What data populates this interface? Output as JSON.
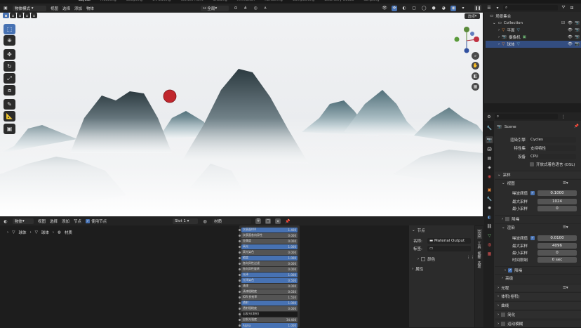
{
  "topbar": {
    "tabs": [
      "Layout",
      "Modeling",
      "Sculpting",
      "UV Editing",
      "Texture Paint",
      "Shading",
      "Animation",
      "Rendering",
      "Compositing",
      "Geometry Nodes",
      "Scripting"
    ],
    "active_tab": "Layout"
  },
  "viewport_header": {
    "mode": "物体模式",
    "menus": [
      "视图",
      "选择",
      "添加",
      "物体"
    ],
    "transform_orientation": "全局",
    "options_label": "选项"
  },
  "node_editor": {
    "header": {
      "type": "物体",
      "menus": [
        "视图",
        "选择",
        "添加",
        "节点"
      ],
      "use_nodes_label": "使用节点",
      "slot": "Slot 1",
      "material": "材质"
    },
    "breadcrumb": [
      "球体",
      "球体",
      "材质"
    ],
    "bsdf_rows": [
      {
        "label": "次表面IOR",
        "value": "1.400",
        "style": "b"
      },
      {
        "label": "次表面各向异性",
        "value": "0.000",
        "style": "g"
      },
      {
        "label": "金属度",
        "value": "0.000",
        "style": "g"
      },
      {
        "label": "高光",
        "value": "1.000",
        "style": "b"
      },
      {
        "label": "高光染色",
        "value": "0.000",
        "style": "g"
      },
      {
        "label": "糙度",
        "value": "1.000",
        "style": "b"
      },
      {
        "label": "各向异性过滤",
        "value": "0.000",
        "style": "g"
      },
      {
        "label": "各向异性旋转",
        "value": "0.000",
        "style": "g"
      },
      {
        "label": "光泽",
        "value": "1.000",
        "style": "b"
      },
      {
        "label": "光泽染色",
        "value": "0.500",
        "style": "b"
      },
      {
        "label": "清漆",
        "value": "0.000",
        "style": "g"
      },
      {
        "label": "清漆粗糙度",
        "value": "0.030",
        "style": "g"
      },
      {
        "label": "IOR 折射率",
        "value": "1.550",
        "style": "g"
      },
      {
        "label": "透射",
        "value": "1.000",
        "style": "b"
      },
      {
        "label": "透射粗糙度",
        "value": "0.000",
        "style": "g"
      },
      {
        "label": "自发光(发射)",
        "value": "",
        "style": "d"
      },
      {
        "label": "自发光强度",
        "value": "34.400",
        "style": "g"
      },
      {
        "label": "Alpha",
        "value": "1.000",
        "style": "b"
      }
    ],
    "sidebar": {
      "tabs": [
        "节点",
        "工具",
        "视图",
        "选项"
      ],
      "node_section": "节点",
      "name_label": "名称:",
      "name_value": "Material Output",
      "label_label": "标签:",
      "color_section": "颜色",
      "props_section": "属性"
    }
  },
  "outliner": {
    "search_placeholder": "",
    "rows": [
      {
        "label": "场景集合",
        "indent": 0
      },
      {
        "label": "Collection",
        "indent": 1
      },
      {
        "label": "平面",
        "indent": 2
      },
      {
        "label": "摄像机",
        "indent": 2
      },
      {
        "label": "球体",
        "indent": 2
      }
    ],
    "selected_index": 4
  },
  "properties": {
    "scene_name": "Scene",
    "render_engine_label": "渲染引擎",
    "render_engine": "Cycles",
    "feature_set_label": "特性集",
    "feature_set": "支持特性",
    "device_label": "设备",
    "device": "CPU",
    "osl_label": "开放式着色语言 (OSL)",
    "sampling": "采样",
    "viewport": "视图",
    "noise_threshold_label": "噪波阈值",
    "viewport_noise_threshold": "0.1000",
    "max_samples_label": "最大采样",
    "viewport_max_samples": "1024",
    "min_samples_label": "最小采样",
    "viewport_min_samples": "0",
    "denoise": "降噪",
    "render": "渲染",
    "render_noise_threshold": "0.0100",
    "render_max_samples": "4096",
    "render_min_samples": "0",
    "time_limit_label": "时间限制",
    "time_limit": "0 sec",
    "render_denoise": "降噪",
    "advanced": "高级",
    "sections": [
      "光程",
      "体积(卷积)",
      "曲线",
      "简化",
      "运动模糊"
    ]
  },
  "colors": {
    "accent": "#4772b3",
    "sun": "#c0272d",
    "sky": "#e9ebee"
  }
}
